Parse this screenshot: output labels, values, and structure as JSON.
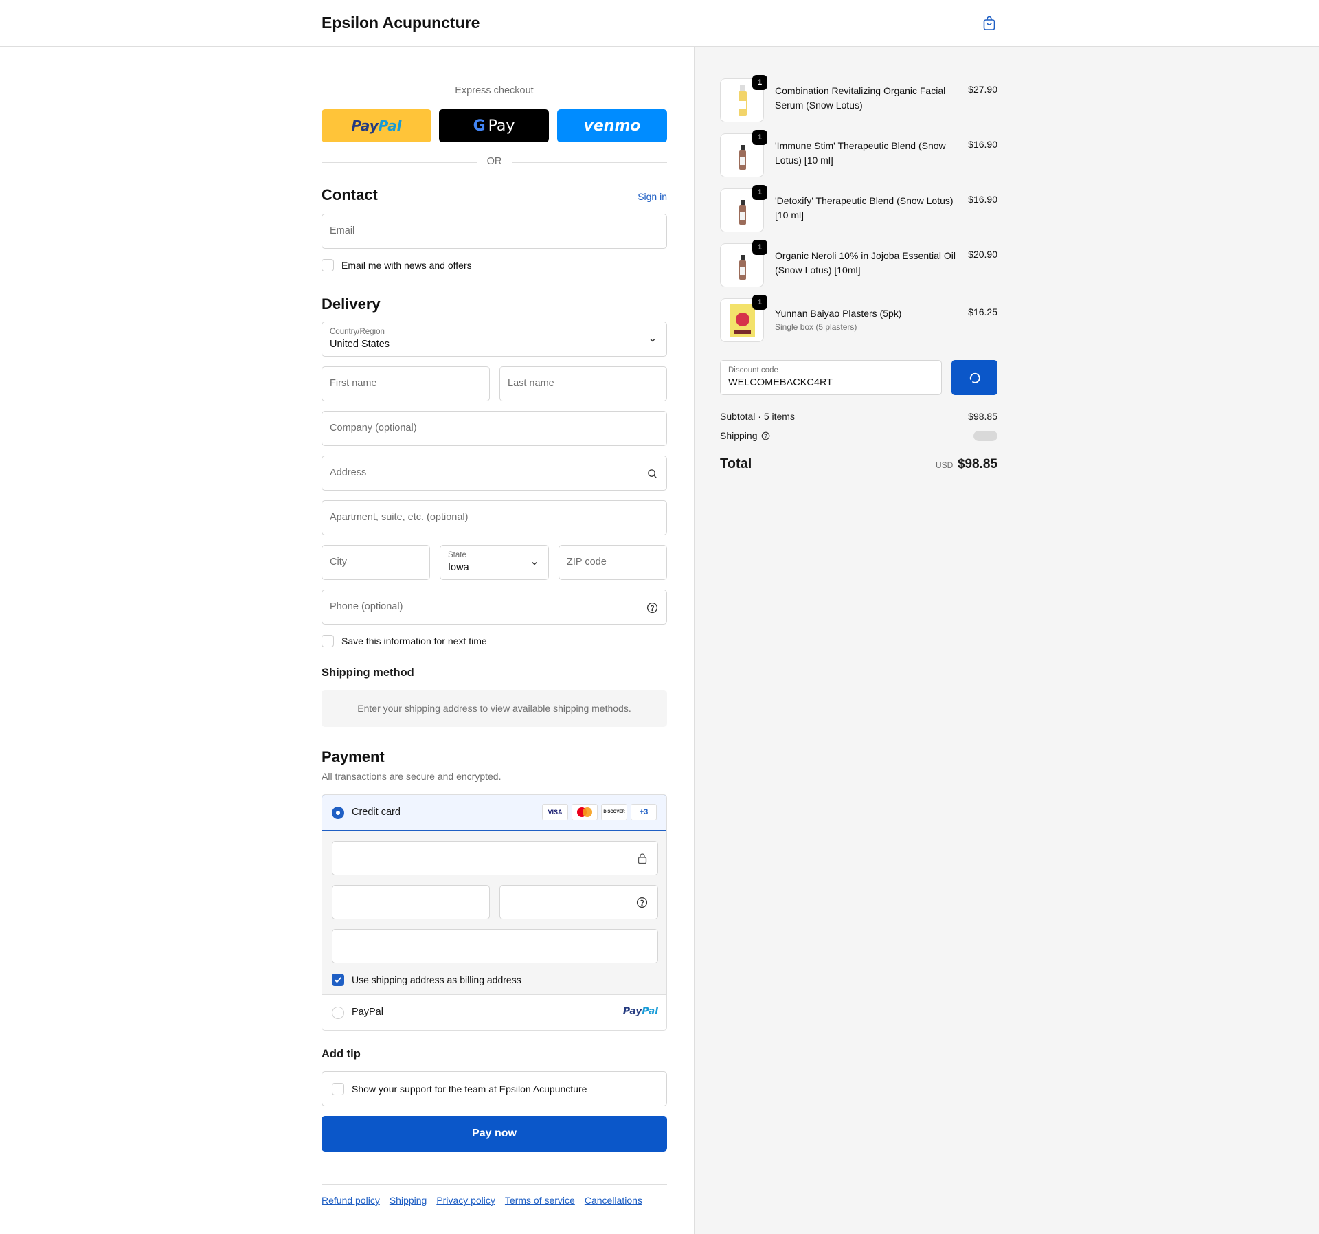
{
  "header": {
    "shop_name": "Epsilon Acupuncture",
    "cart_icon": "shopping-bag-icon"
  },
  "express": {
    "label": "Express checkout",
    "paypal": "PayPal",
    "gpay": "Pay",
    "venmo": "venmo",
    "or": "OR"
  },
  "contact": {
    "title": "Contact",
    "sign_in": "Sign in",
    "email_placeholder": "Email",
    "news_label": "Email me with news and offers"
  },
  "delivery": {
    "title": "Delivery",
    "country_label": "Country/Region",
    "country_value": "United States",
    "first_name": "First name",
    "last_name": "Last name",
    "company": "Company (optional)",
    "address": "Address",
    "apartment": "Apartment, suite, etc. (optional)",
    "city": "City",
    "state_label": "State",
    "state_value": "Iowa",
    "zip": "ZIP code",
    "phone": "Phone (optional)",
    "save_label": "Save this information for next time"
  },
  "shipping_method": {
    "title": "Shipping method",
    "info": "Enter your shipping address to view available shipping methods."
  },
  "payment": {
    "title": "Payment",
    "subtitle": "All transactions are secure and encrypted.",
    "credit_card": "Credit card",
    "cards": [
      "VISA",
      "MC",
      "DISCOVER",
      "+3"
    ],
    "billing_label": "Use shipping address as billing address",
    "paypal_label": "PayPal",
    "paypal_logo": "PayPal"
  },
  "tip": {
    "title": "Add tip",
    "label": "Show your support for the team at Epsilon Acupuncture"
  },
  "pay_now": "Pay now",
  "footer": {
    "links": [
      "Refund policy",
      "Shipping",
      "Privacy policy",
      "Terms of service",
      "Cancellations"
    ]
  },
  "order": {
    "items": [
      {
        "name": "Combination Revitalizing Organic Facial Serum (Snow Lotus)",
        "price": "$27.90",
        "qty": "1",
        "sub": ""
      },
      {
        "name": "'Immune Stim' Therapeutic Blend (Snow Lotus) [10 ml]",
        "price": "$16.90",
        "qty": "1",
        "sub": ""
      },
      {
        "name": "'Detoxify' Therapeutic Blend (Snow Lotus) [10 ml]",
        "price": "$16.90",
        "qty": "1",
        "sub": ""
      },
      {
        "name": "Organic Neroli 10% in Jojoba Essential Oil (Snow Lotus) [10ml]",
        "price": "$20.90",
        "qty": "1",
        "sub": ""
      },
      {
        "name": "Yunnan Baiyao Plasters (5pk)",
        "price": "$16.25",
        "qty": "1",
        "sub": "Single box (5 plasters)"
      }
    ],
    "discount_label": "Discount code",
    "discount_value": "WELCOMEBACKC4RT",
    "subtotal_label": "Subtotal · 5 items",
    "subtotal_value": "$98.85",
    "shipping_label": "Shipping",
    "total_label": "Total",
    "currency": "USD",
    "total_value": "$98.85"
  },
  "colors": {
    "accent": "#0b57c9",
    "paypal_yellow": "#ffc439",
    "venmo_blue": "#008cff"
  }
}
